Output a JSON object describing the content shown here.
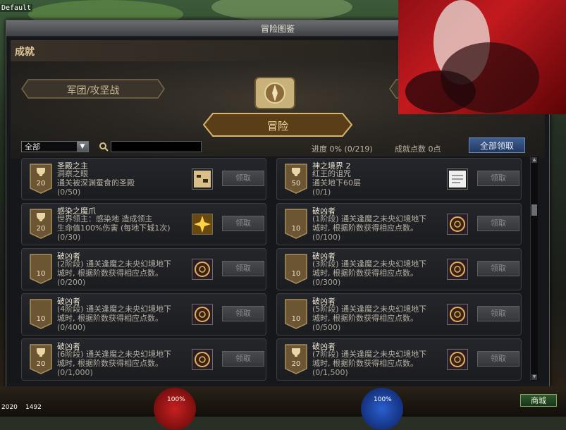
{
  "overlay": {
    "default_tag": "Default"
  },
  "window": {
    "title": "冒险图鉴",
    "section": "成就",
    "tabs": {
      "left": "军团/攻坚战",
      "center": "冒险"
    }
  },
  "filter": {
    "category": "全部",
    "progress_label": "进度  0%  (0/219)",
    "points_label": "成就点数 0点",
    "claim_all": "全部领取"
  },
  "achievements": [
    {
      "title": "圣殿之主",
      "desc": "洞察之眼\n通关被深渊蚕食的圣殿",
      "progress": "(0/50)",
      "points": "20",
      "icon": "map-icon",
      "claim": "领取"
    },
    {
      "title": "神之境界 2",
      "desc": "红王的诅咒\n通关地下60层",
      "progress": "(0/1)",
      "points": "50",
      "icon": "scroll-icon",
      "claim": "领取"
    },
    {
      "title": "感染之魔爪",
      "desc": "世界领主：感染地      造成领主\n生命值100%伤害 (每地下城1次)",
      "progress": "(0/30)",
      "points": "20",
      "icon": "burst-icon",
      "claim": "领取"
    },
    {
      "title": "破凶者",
      "desc": "(1阶段) 通关逢魔之未央幻境地下\n城时, 根据阶数获得相应点数。",
      "progress": "(0/100)",
      "points": "10",
      "icon": "emblem-icon",
      "claim": "领取"
    },
    {
      "title": "破凶者",
      "desc": "(2阶段) 通关逢魔之未央幻境地下\n城时, 根据阶数获得相应点数。",
      "progress": "(0/200)",
      "points": "10",
      "icon": "emblem-icon",
      "claim": "领取"
    },
    {
      "title": "破凶者",
      "desc": "(3阶段) 通关逢魔之未央幻境地下\n城时, 根据阶数获得相应点数。",
      "progress": "(0/300)",
      "points": "10",
      "icon": "emblem-icon",
      "claim": "领取"
    },
    {
      "title": "破凶者",
      "desc": "(4阶段) 通关逢魔之未央幻境地下\n城时, 根据阶数获得相应点数。",
      "progress": "(0/400)",
      "points": "10",
      "icon": "emblem-icon",
      "claim": "领取"
    },
    {
      "title": "破凶者",
      "desc": "(5阶段) 通关逢魔之未央幻境地下\n城时, 根据阶数获得相应点数。",
      "progress": "(0/500)",
      "points": "10",
      "icon": "emblem-icon",
      "claim": "领取"
    },
    {
      "title": "破凶者",
      "desc": "(6阶段) 通关逢魔之未央幻境地下\n城时, 根据阶数获得相应点数。",
      "progress": "(0/1,000)",
      "points": "20",
      "icon": "emblem-icon",
      "claim": "领取"
    },
    {
      "title": "破凶者",
      "desc": "(7阶段) 通关逢魔之未央幻境地下\n城时, 根据阶数获得相应点数。",
      "progress": "(0/1,500)",
      "points": "20",
      "icon": "emblem-icon",
      "claim": "领取"
    }
  ],
  "hud": {
    "hp": "100%",
    "mp": "100%",
    "year": "2020",
    "id": "1492",
    "shop": "商城"
  },
  "colors": {
    "accent": "#e0c79a",
    "claim_all": "#2f4f82",
    "promo_red": "#c31a1f"
  }
}
